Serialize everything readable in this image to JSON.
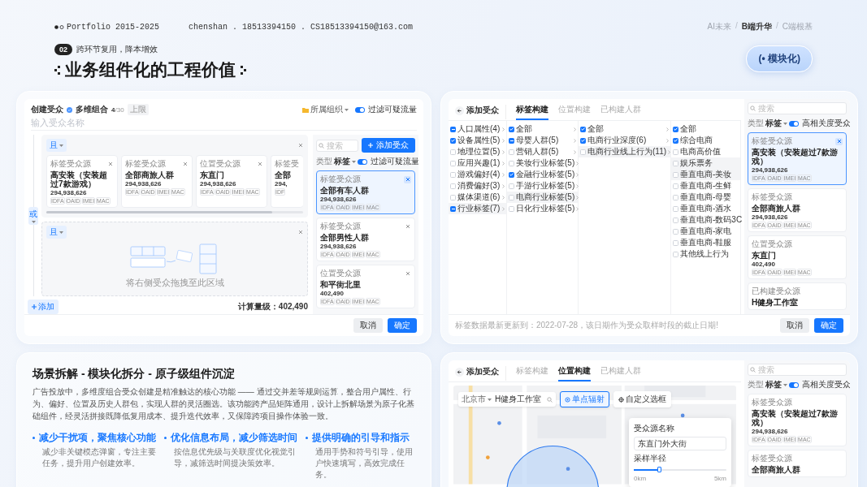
{
  "header": {
    "brand": "Portfolio 2015-2025",
    "contact": "chenshan . 18513394150 . CS18513394150@163.com",
    "separator": "/",
    "nav": [
      {
        "label": "AI未来",
        "selected": false
      },
      {
        "label": "B端升华",
        "selected": true
      },
      {
        "label": "C端根基",
        "selected": false
      }
    ]
  },
  "section": {
    "number": "02",
    "subtitle": "跨环节复用，降本增效",
    "title": "业务组件化的工程价值",
    "pill": "(• 模块化)"
  },
  "builder": {
    "title": "创建受众",
    "mode": "多维组合",
    "count": "4",
    "limit": "/30",
    "limit_badge": "上限",
    "org": "所属组织",
    "toggle": {
      "label": "过滤可疑流量",
      "on": true
    },
    "name_placeholder": "输入受众名称",
    "connector": "或",
    "groups": [
      {
        "kind": "cards",
        "operator": "且",
        "cards": [
          {
            "kind": "full",
            "source": "标签受众源",
            "name": "高安装（安装超过7款游戏）",
            "count": "294,938,626",
            "tags": [
              "IDFA",
              "OAID",
              "IMEI",
              "MAC"
            ],
            "closable": true
          },
          {
            "kind": "full",
            "source": "标签受众源",
            "name": "全部商旅人群",
            "count": "294,938,626",
            "tags": [
              "IDFA",
              "OAID",
              "IMEI",
              "MAC"
            ],
            "closable": true
          },
          {
            "kind": "full",
            "source": "位置受众源",
            "name": "东直门",
            "count": "294,938,626",
            "tags": [
              "IDFA",
              "OAID",
              "IMEI",
              "MAC"
            ],
            "closable": true
          },
          {
            "kind": "partial",
            "source": "标签受",
            "name": "全部",
            "count": "294,",
            "tags": [
              "IDF"
            ]
          }
        ]
      },
      {
        "kind": "empty",
        "operator": "且",
        "hint": "将右侧受众拖拽至此区域"
      }
    ],
    "add": "添加",
    "total": "计算量级：402,490",
    "panel": {
      "search_placeholder": "搜索",
      "add_button": "添加受众",
      "type_label": "类型",
      "type_value": "标签",
      "toggle": {
        "label": "过滤可疑流量",
        "on": true
      },
      "cards": [
        {
          "source": "标签受众源",
          "name": "全部有车人群",
          "count": "294,938,626",
          "tags": [
            "IDFA",
            "OAID",
            "IMEI",
            "MAC"
          ],
          "selected": true,
          "closable": true
        },
        {
          "source": "标签受众源",
          "name": "全部男性人群",
          "count": "294,938,626",
          "tags": [
            "IDFA",
            "OAID",
            "IMEI",
            "MAC"
          ],
          "selected": false,
          "closable": true
        },
        {
          "source": "位置受众源",
          "name": "和平街北里",
          "count": "402,490",
          "tags": [
            "IDFA",
            "OAID",
            "IMEI",
            "MAC"
          ],
          "selected": false,
          "closable": true
        }
      ]
    },
    "buttons": [
      {
        "label": "取消",
        "primary": false
      },
      {
        "label": "确定",
        "primary": true
      }
    ]
  },
  "tag_picker": {
    "back": "添加受众",
    "tabs": [
      {
        "label": "标签构建",
        "selected": true
      },
      {
        "label": "位置构建",
        "selected": false
      },
      {
        "label": "已构建人群",
        "selected": false
      }
    ],
    "columns": [
      {
        "expandable": true,
        "items": [
          {
            "label": "人口属性(4)",
            "checked": false,
            "indeterminate": true,
            "selected": false
          },
          {
            "label": "设备属性(5)",
            "checked": true,
            "indeterminate": false,
            "selected": false
          },
          {
            "label": "地理位置(5)",
            "checked": false,
            "indeterminate": false,
            "selected": false
          },
          {
            "label": "应用兴趣(1)",
            "checked": false,
            "indeterminate": false,
            "selected": false
          },
          {
            "label": "游戏偏好(4)",
            "checked": false,
            "indeterminate": false,
            "selected": false
          },
          {
            "label": "消费偏好(3)",
            "checked": false,
            "indeterminate": false,
            "selected": false
          },
          {
            "label": "媒体渠道(6)",
            "checked": false,
            "indeterminate": false,
            "selected": false
          },
          {
            "label": "行业标签(7)",
            "checked": false,
            "indeterminate": true,
            "selected": true
          }
        ]
      },
      {
        "expandable": true,
        "items": [
          {
            "label": "全部",
            "checked": true,
            "indeterminate": false,
            "selected": false
          },
          {
            "label": "母婴人群(5)",
            "checked": false,
            "indeterminate": true,
            "selected": false
          },
          {
            "label": "营销人群(5)",
            "checked": false,
            "indeterminate": false,
            "selected": false
          },
          {
            "label": "美妆行业标签(5)",
            "checked": false,
            "indeterminate": false,
            "selected": false
          },
          {
            "label": "金融行业标签(5)",
            "checked": true,
            "indeterminate": false,
            "selected": false
          },
          {
            "label": "手游行业标签(5)",
            "checked": false,
            "indeterminate": false,
            "selected": false
          },
          {
            "label": "电商行业标签(5)",
            "checked": false,
            "indeterminate": false,
            "selected": true
          },
          {
            "label": "日化行业标签(5)",
            "checked": false,
            "indeterminate": false,
            "selected": false
          }
        ]
      },
      {
        "expandable": true,
        "items": [
          {
            "label": "全部",
            "checked": true,
            "indeterminate": false,
            "selected": false
          },
          {
            "label": "电商行业深度(6)",
            "checked": true,
            "indeterminate": false,
            "selected": false
          },
          {
            "label": "电商行业线上行为(11)",
            "checked": false,
            "indeterminate": false,
            "selected": true
          }
        ]
      },
      {
        "expandable": false,
        "items": [
          {
            "label": "全部",
            "checked": true,
            "indeterminate": false,
            "selected": false
          },
          {
            "label": "综合电商",
            "checked": true,
            "indeterminate": false,
            "selected": false
          },
          {
            "label": "电商高价值",
            "checked": false,
            "indeterminate": false,
            "selected": false
          },
          {
            "label": "娱乐票务",
            "checked": false,
            "indeterminate": false,
            "selected": true
          },
          {
            "label": "垂直电商-美妆",
            "checked": false,
            "indeterminate": false,
            "selected": true
          },
          {
            "label": "垂直电商-生鲜",
            "checked": false,
            "indeterminate": false,
            "selected": false
          },
          {
            "label": "垂直电商-母婴",
            "checked": false,
            "indeterminate": false,
            "selected": false
          },
          {
            "label": "垂直电商-酒水",
            "checked": false,
            "indeterminate": false,
            "selected": false
          },
          {
            "label": "垂直电商-数码3C",
            "checked": false,
            "indeterminate": false,
            "selected": false
          },
          {
            "label": "垂直电商-家电",
            "checked": false,
            "indeterminate": false,
            "selected": false
          },
          {
            "label": "垂直电商-鞋服",
            "checked": false,
            "indeterminate": false,
            "selected": false
          },
          {
            "label": "其他线上行为",
            "checked": false,
            "indeterminate": false,
            "selected": false
          }
        ]
      }
    ],
    "note": "标签数据最新更新到：2022-07-28，该日期作为受众取样时段的截止日期!",
    "panel": {
      "search_placeholder": "搜索",
      "type_label": "类型",
      "type_value": "标签",
      "toggle": {
        "label": "高相关度受众",
        "on": true
      },
      "cards": [
        {
          "source": "标签受众源",
          "name": "高安装（安装超过7款游戏）",
          "count": "294,938,626",
          "tags": [
            "IDFA",
            "OAID",
            "IMEI",
            "MAC"
          ],
          "selected": true,
          "closable": true
        },
        {
          "source": "标签受众源",
          "name": "全部商旅人群",
          "count": "294,938,626",
          "tags": [
            "IDFA",
            "OAID",
            "IMEI",
            "MAC"
          ],
          "selected": false,
          "closable": false
        },
        {
          "source": "位置受众源",
          "name": "东直门",
          "count": "402,490",
          "tags": [
            "IDFA",
            "OAID",
            "IMEI",
            "MAC"
          ],
          "selected": false,
          "closable": false
        },
        {
          "source": "已构建受众源",
          "name": "H健身工作室",
          "selected": false,
          "closable": false
        }
      ]
    },
    "buttons": [
      {
        "label": "取消",
        "primary": false
      },
      {
        "label": "确定",
        "primary": true
      }
    ]
  },
  "intro": {
    "title": "场景拆解 - 模块化拆分 - 原子级组件沉淀",
    "body": "广告投放中，多维度组合受众创建是精准触达的核心功能 —— 通过交并差等规则运算，整合用户属性、行为、偏好、位置及历史人群包，实现人群的灵活圈选。该功能跨产品矩阵通用，设计上拆解场景为原子化基础组件，经灵活拼接既降低复用成本、提升迭代效率，又保障跨项目操作体验一致。",
    "points": [
      {
        "title": "减少干扰项，聚焦核心功能",
        "text": "减少非关键模态弹窗，专注主要任务，提升用户创建效率。"
      },
      {
        "title": "优化信息布局，减少筛选时间",
        "text": "按信息优先级与关联度优化视觉引导，减筛选时间提决策效率。"
      },
      {
        "title": "提供明确的引导和指示",
        "text": "通用手势和符号引导，使用户快速填写，高效完成任务。"
      }
    ]
  },
  "location_picker": {
    "back": "添加受众",
    "tabs": [
      {
        "label": "标签构建",
        "selected": false
      },
      {
        "label": "位置构建",
        "selected": true
      },
      {
        "label": "已构建人群",
        "selected": false
      }
    ],
    "city": "北京市",
    "search_value": "H健身工作室",
    "modes": [
      {
        "label": "单点辐射",
        "selected": true
      },
      {
        "label": "自定义选框",
        "selected": false
      }
    ],
    "popup": {
      "name_label": "受众源名称",
      "name_value": "东直门外大街",
      "radius_label": "采样半径",
      "level": 0.28,
      "min": "0km",
      "max": "5km"
    },
    "panel": {
      "search_placeholder": "搜索",
      "type_label": "类型",
      "type_value": "标签",
      "toggle": {
        "label": "高相关度受众",
        "on": true
      },
      "cards": [
        {
          "source": "标签受众源",
          "name": "高安装（安装超过7款游戏）",
          "count": "294,938,626",
          "tags": [
            "IDFA",
            "OAID",
            "IMEI",
            "MAC"
          ],
          "selected": false,
          "closable": false
        },
        {
          "source": "标签受众源",
          "name": "全部商旅人群",
          "selected": false,
          "closable": false
        }
      ]
    }
  }
}
